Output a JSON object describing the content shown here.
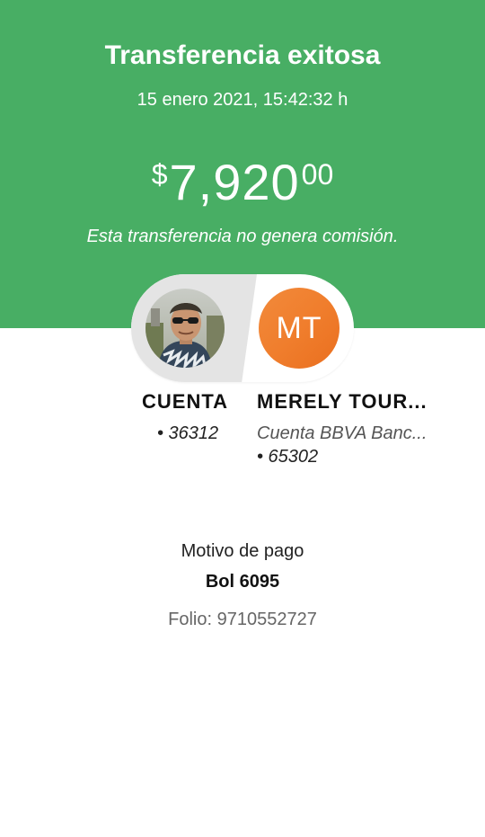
{
  "header": {
    "title": "Transferencia exitosa",
    "datetime": "15 enero 2021, 15:42:32 h",
    "amount": {
      "currency": "$",
      "integer": "7,920",
      "cents": "00"
    },
    "commission_note": "Esta transferencia no genera comisión.",
    "color": "#48ae64"
  },
  "transfer": {
    "from": {
      "avatar": "user-photo",
      "name": "CUENTA",
      "account": "• 36312"
    },
    "to": {
      "initials": "MT",
      "initials_color": "#f07e2d",
      "name": "MERELY TOUR...",
      "bank": "Cuenta BBVA Banc...",
      "account": "• 65302"
    }
  },
  "details": {
    "motivo_label": "Motivo de pago",
    "motivo_value": "Bol 6095",
    "folio": "Folio: 9710552727"
  }
}
